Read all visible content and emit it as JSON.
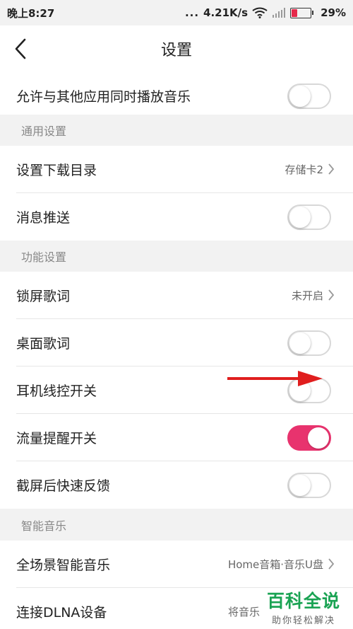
{
  "status_bar": {
    "time": "晚上8:27",
    "dots": "...",
    "speed": "4.21K/s",
    "battery": "29%",
    "battery_level": 0.29,
    "colors": {
      "battery_low": "#e5294b"
    }
  },
  "header": {
    "title": "设置"
  },
  "rows": {
    "mix_play": {
      "label": "允许与其他应用同时播放音乐",
      "on": false
    },
    "download_dir": {
      "label": "设置下载目录",
      "value": "存储卡2"
    },
    "push": {
      "label": "消息推送",
      "on": false
    },
    "lock_lyrics": {
      "label": "锁屏歌词",
      "value": "未开启"
    },
    "desktop_lyrics": {
      "label": "桌面歌词",
      "on": false
    },
    "headset": {
      "label": "耳机线控开关",
      "on": false
    },
    "data_alert": {
      "label": "流量提醒开关",
      "on": true
    },
    "screenshot_feedback": {
      "label": "截屏后快速反馈",
      "on": false
    },
    "scene_music": {
      "label": "全场景智能音乐",
      "value": "Home音箱·音乐U盘"
    },
    "dlna": {
      "label": "连接DLNA设备",
      "value": "将音乐"
    }
  },
  "sections": {
    "general": "通用设置",
    "features": "功能设置",
    "smart": "智能音乐"
  },
  "watermark": {
    "main": "百科全说",
    "sub": "助你轻松解决"
  },
  "colors": {
    "toggle_on": "#e8336e",
    "annotation_arrow": "#e01e1e",
    "watermark": "#1aa353"
  }
}
